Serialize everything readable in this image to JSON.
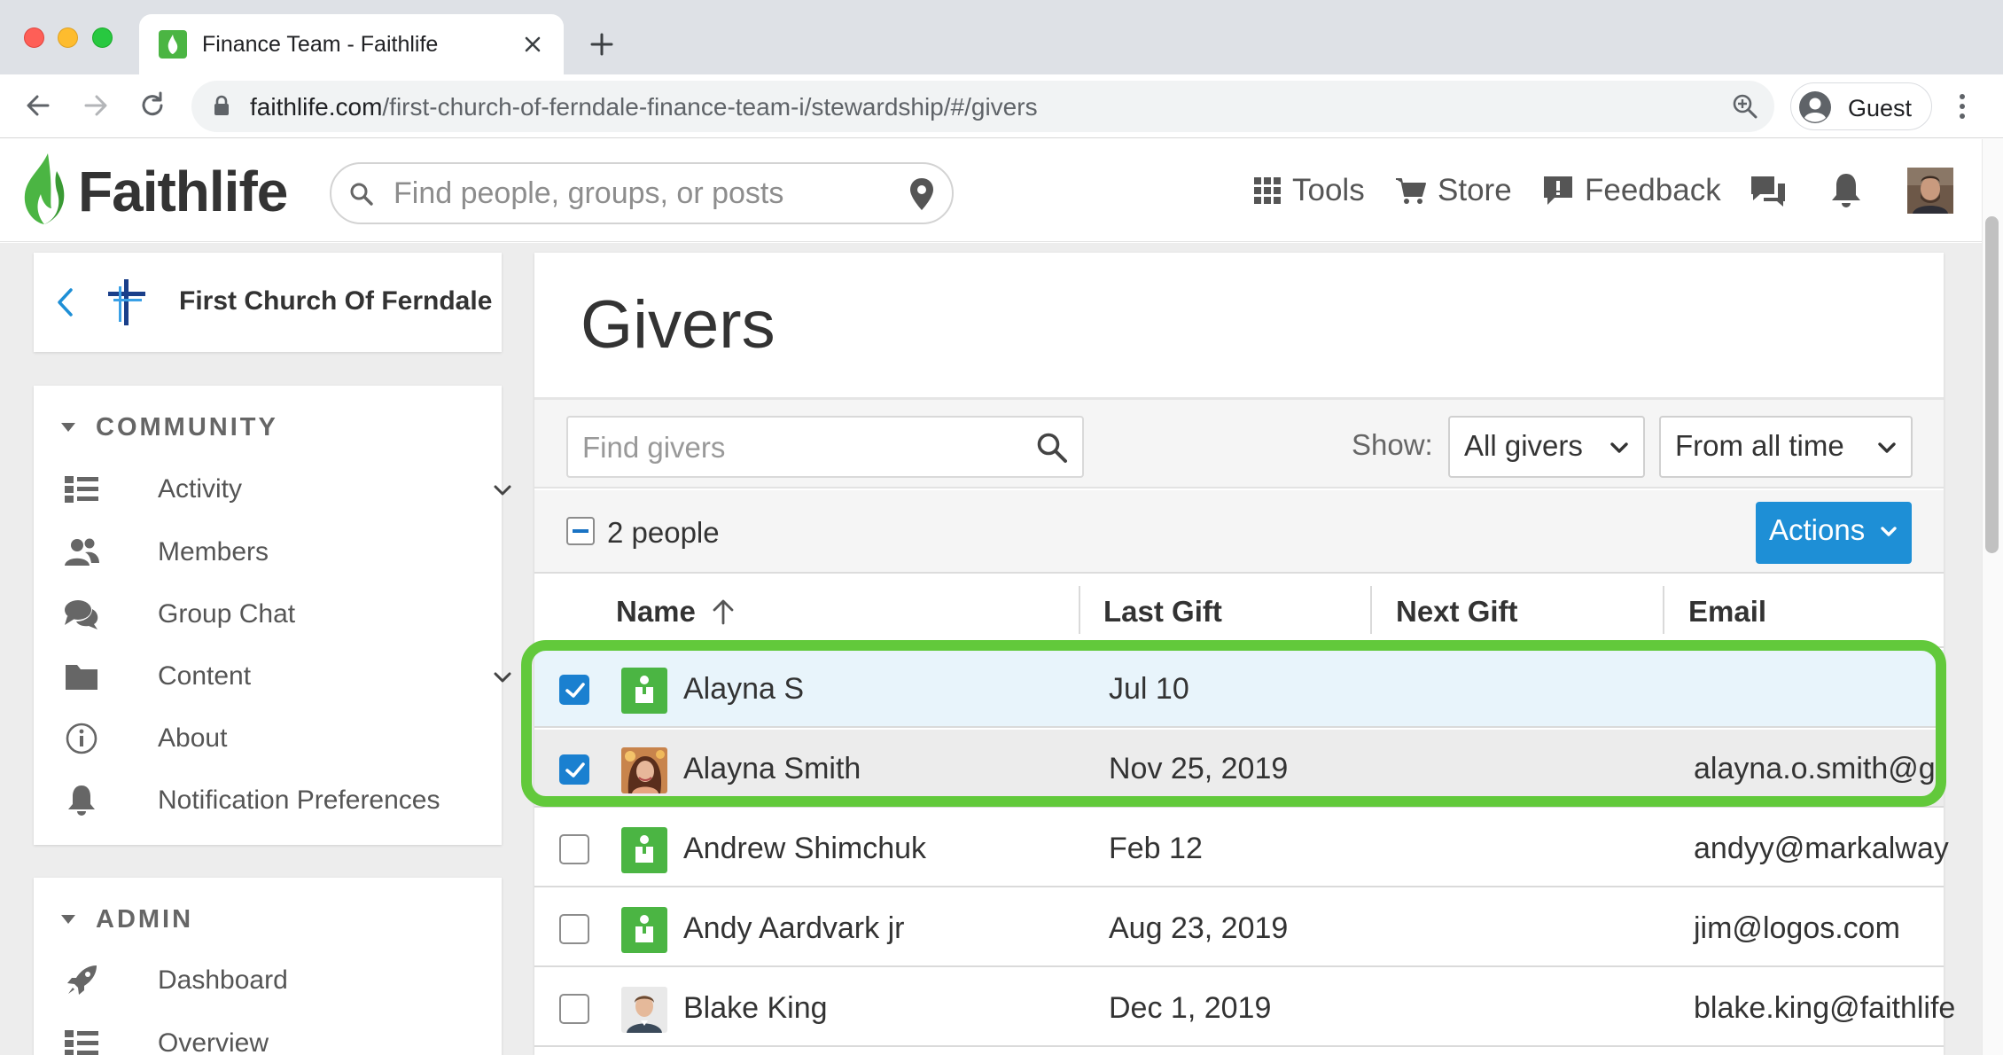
{
  "browser": {
    "tab_title": "Finance Team - Faithlife",
    "url_host": "faithlife.com",
    "url_path": "/first-church-of-ferndale-finance-team-i/stewardship/#/givers",
    "profile_label": "Guest"
  },
  "header": {
    "logo_text": "Faithlife",
    "search_placeholder": "Find people, groups, or posts",
    "nav": {
      "tools": "Tools",
      "store": "Store",
      "feedback": "Feedback"
    }
  },
  "sidebar": {
    "group_name": "First Church Of Ferndale",
    "community_heading": "COMMUNITY",
    "community_items": [
      {
        "label": "Activity",
        "icon": "activity-icon",
        "expandable": true
      },
      {
        "label": "Members",
        "icon": "members-icon",
        "expandable": false
      },
      {
        "label": "Group Chat",
        "icon": "chat-icon",
        "expandable": false
      },
      {
        "label": "Content",
        "icon": "folder-icon",
        "expandable": true
      },
      {
        "label": "About",
        "icon": "info-icon",
        "expandable": false
      },
      {
        "label": "Notification Preferences",
        "icon": "bell-icon",
        "expandable": false
      }
    ],
    "admin_heading": "ADMIN",
    "admin_items": [
      {
        "label": "Dashboard",
        "icon": "rocket-icon"
      },
      {
        "label": "Overview",
        "icon": "overview-icon"
      }
    ]
  },
  "main": {
    "title": "Givers",
    "find_placeholder": "Find givers",
    "show_label": "Show:",
    "filter_givers": "All givers",
    "filter_time": "From all time",
    "people_count": "2 people",
    "actions_label": "Actions",
    "columns": [
      "Name",
      "Last Gift",
      "Next Gift",
      "Email"
    ],
    "rows": [
      {
        "name": "Alayna S",
        "last_gift": "Jul 10",
        "next_gift": "",
        "email": "",
        "checked": true,
        "avatar": "default"
      },
      {
        "name": "Alayna Smith",
        "last_gift": "Nov 25, 2019",
        "next_gift": "",
        "email": "alayna.o.smith@g",
        "checked": true,
        "avatar": "photo-woman"
      },
      {
        "name": "Andrew Shimchuk",
        "last_gift": "Feb 12",
        "next_gift": "",
        "email": "andyy@markalway",
        "checked": false,
        "avatar": "default"
      },
      {
        "name": "Andy Aardvark jr",
        "last_gift": "Aug 23, 2019",
        "next_gift": "",
        "email": "jim@logos.com",
        "checked": false,
        "avatar": "default"
      },
      {
        "name": "Blake King",
        "last_gift": "Dec 1, 2019",
        "next_gift": "",
        "email": "blake.king@faithlife",
        "checked": false,
        "avatar": "photo-man"
      }
    ]
  },
  "colors": {
    "brand_green": "#4bb543",
    "highlight_green": "#62c93b",
    "accent_blue": "#1e8fd6"
  }
}
